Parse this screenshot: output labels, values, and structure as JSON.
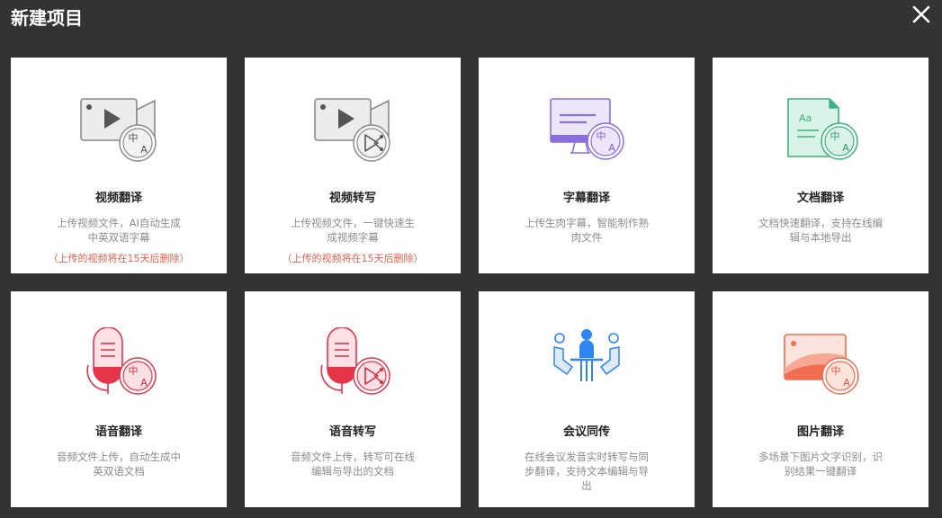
{
  "header": {
    "title": "新建项目",
    "close_icon": "close-icon"
  },
  "colors": {
    "background": "#333333",
    "card": "#ffffff",
    "note": "#e8604c"
  },
  "cards": [
    {
      "title": "视频翻译",
      "desc": "上传视频文件，AI自动生成中英双语字幕",
      "note": "（上传的视频将在15天后删除）",
      "icon": "video-translate-icon"
    },
    {
      "title": "视频转写",
      "desc": "上传视频文件，一键快速生成视频字幕",
      "note": "（上传的视频将在15天后删除）",
      "icon": "video-transcribe-icon"
    },
    {
      "title": "字幕翻译",
      "desc": "上传生肉字幕，智能制作熟肉文件",
      "note": "",
      "icon": "subtitle-translate-icon"
    },
    {
      "title": "文档翻译",
      "desc": "文档快速翻译，支持在线编辑与本地导出",
      "note": "",
      "icon": "document-translate-icon"
    },
    {
      "title": "语音翻译",
      "desc": "音频文件上传，自动生成中英双语文档",
      "note": "",
      "icon": "voice-translate-icon"
    },
    {
      "title": "语音转写",
      "desc": "音频文件上传，转写可在线编辑与导出的文档",
      "note": "",
      "icon": "voice-transcribe-icon"
    },
    {
      "title": "会议同传",
      "desc": "在线会议发音实时转写与同步翻译，支持文本编辑与导出",
      "note": "",
      "icon": "meeting-interpret-icon"
    },
    {
      "title": "图片翻译",
      "desc": "多场景下图片文字识别，识别结果一键翻译",
      "note": "",
      "icon": "image-translate-icon"
    }
  ]
}
